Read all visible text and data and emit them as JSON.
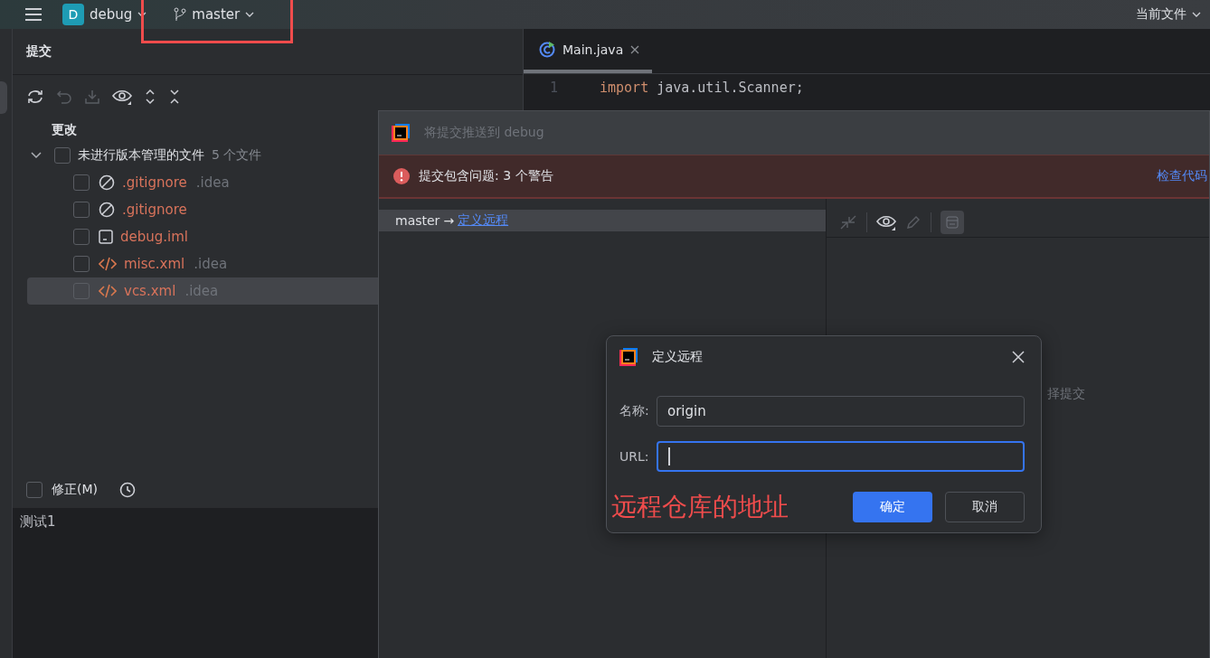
{
  "top_bar": {
    "project_badge": "D",
    "project": "debug",
    "branch": "master",
    "scope": "当前文件"
  },
  "commit_panel": {
    "title": "提交",
    "group": "更改",
    "tree": [
      {
        "label": "未进行版本管理的文件",
        "count": "5 个文件",
        "expanded": true,
        "checked": false,
        "children": [
          {
            "name": ".gitignore",
            "dir": ".idea",
            "kind": "ignore",
            "checked": false,
            "selected": false
          },
          {
            "name": ".gitignore",
            "kind": "ignore",
            "checked": false,
            "selected": false
          },
          {
            "name": "debug.iml",
            "kind": "module",
            "checked": false,
            "selected": false
          },
          {
            "name": "misc.xml",
            "dir": ".idea",
            "kind": "xml",
            "checked": false,
            "selected": false
          },
          {
            "name": "vcs.xml",
            "dir": ".idea",
            "kind": "xml",
            "checked": false,
            "selected": true
          }
        ]
      }
    ],
    "amend": {
      "label": "修正(M)",
      "checked": false
    },
    "message": "测试1"
  },
  "editor": {
    "tabs": [
      {
        "label": "Main.java",
        "selected": true
      }
    ],
    "lines": [
      {
        "number": "1",
        "tokens": [
          {
            "text": "import",
            "kind": "keyword"
          },
          {
            "text": "java.util.Scanner;",
            "kind": "plain"
          }
        ]
      }
    ]
  },
  "push_dialog": {
    "title": "将提交推送到 debug",
    "warning": "提交包含问题: 3 个警告",
    "warning_link": "检查代码",
    "branches": [
      {
        "branch": "master",
        "arrow": "→",
        "target": "定义远程",
        "selected": true
      }
    ],
    "right_hint": "择提交"
  },
  "remote_dialog": {
    "title": "定义远程",
    "fields": [
      {
        "label": "名称:",
        "value": "origin",
        "focused": false
      },
      {
        "label": "URL:",
        "focused": true
      }
    ],
    "buttons": [
      {
        "label": "确定",
        "kind": "primary"
      },
      {
        "label": "取消",
        "kind": "secondary"
      }
    ]
  },
  "annotation": {
    "text": "远程仓库的地址"
  }
}
